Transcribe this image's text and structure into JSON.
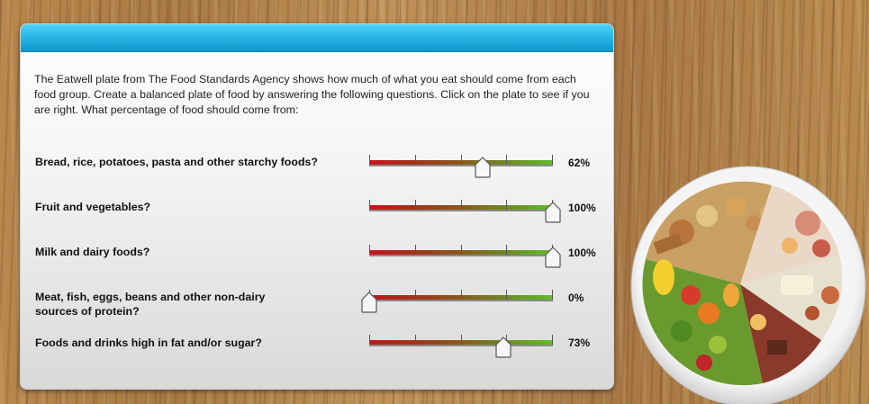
{
  "intro": "The Eatwell plate from The Food Standards Agency shows how much of what you eat should come from each food group. Create a balanced plate of food by answering the following questions. Click on the plate to see if you are right. What percentage of food should come from:",
  "questions": [
    {
      "label": "Bread, rice, potatoes, pasta and other starchy foods?",
      "value_label": "62%",
      "value": 62
    },
    {
      "label": "Fruit and vegetables?",
      "value_label": "100%",
      "value": 100
    },
    {
      "label": "Milk and dairy foods?",
      "value_label": "100%",
      "value": 100
    },
    {
      "label": "Meat, fish, eggs, beans and other non-dairy sources of protein?",
      "value_label": "0%",
      "value": 0
    },
    {
      "label": "Foods and drinks high in fat and/or sugar?",
      "value_label": "73%",
      "value": 73
    }
  ],
  "colors": {
    "header": "#21b3e3",
    "track_low": "#c8141b",
    "track_high": "#5fbf25"
  },
  "icons": {
    "plate": "eatwell-plate-image"
  }
}
